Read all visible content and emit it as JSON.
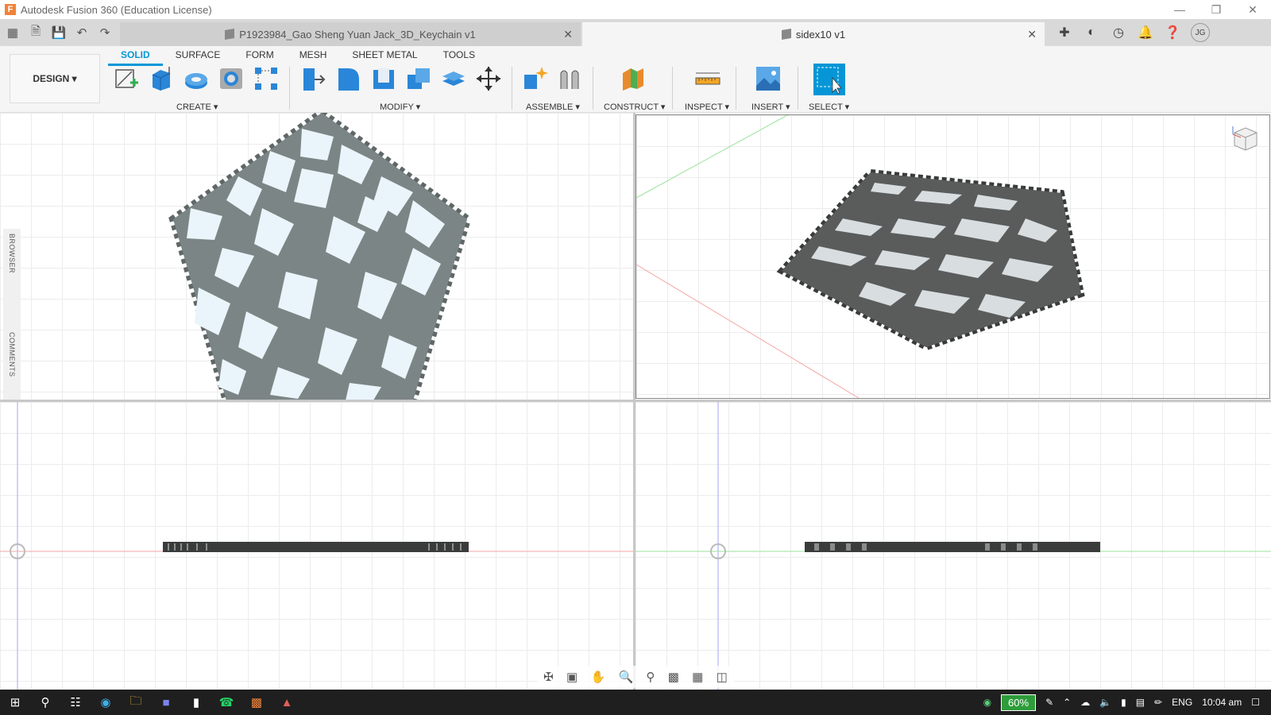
{
  "window": {
    "title": "Autodesk Fusion 360 (Education License)"
  },
  "tabs": [
    {
      "label": "P1923984_Gao Sheng Yuan Jack_3D_Keychain v1",
      "active": false
    },
    {
      "label": "sidex10 v1",
      "active": true
    }
  ],
  "user": {
    "initials": "JG"
  },
  "workspace": {
    "label": "DESIGN"
  },
  "ribbon_tabs": [
    "SOLID",
    "SURFACE",
    "FORM",
    "MESH",
    "SHEET METAL",
    "TOOLS"
  ],
  "groups": {
    "create": "CREATE",
    "modify": "MODIFY",
    "assemble": "ASSEMBLE",
    "construct": "CONSTRUCT",
    "inspect": "INSPECT",
    "insert": "INSERT",
    "select": "SELECT"
  },
  "side_panel": {
    "browser": "BROWSER",
    "comments": "COMMENTS"
  },
  "taskbar": {
    "battery": "60%",
    "language": "ENG",
    "time": "10:04 am"
  },
  "colors": {
    "accent": "#0696d7",
    "model": "#7b8585",
    "fill": "#eaf4fb"
  }
}
